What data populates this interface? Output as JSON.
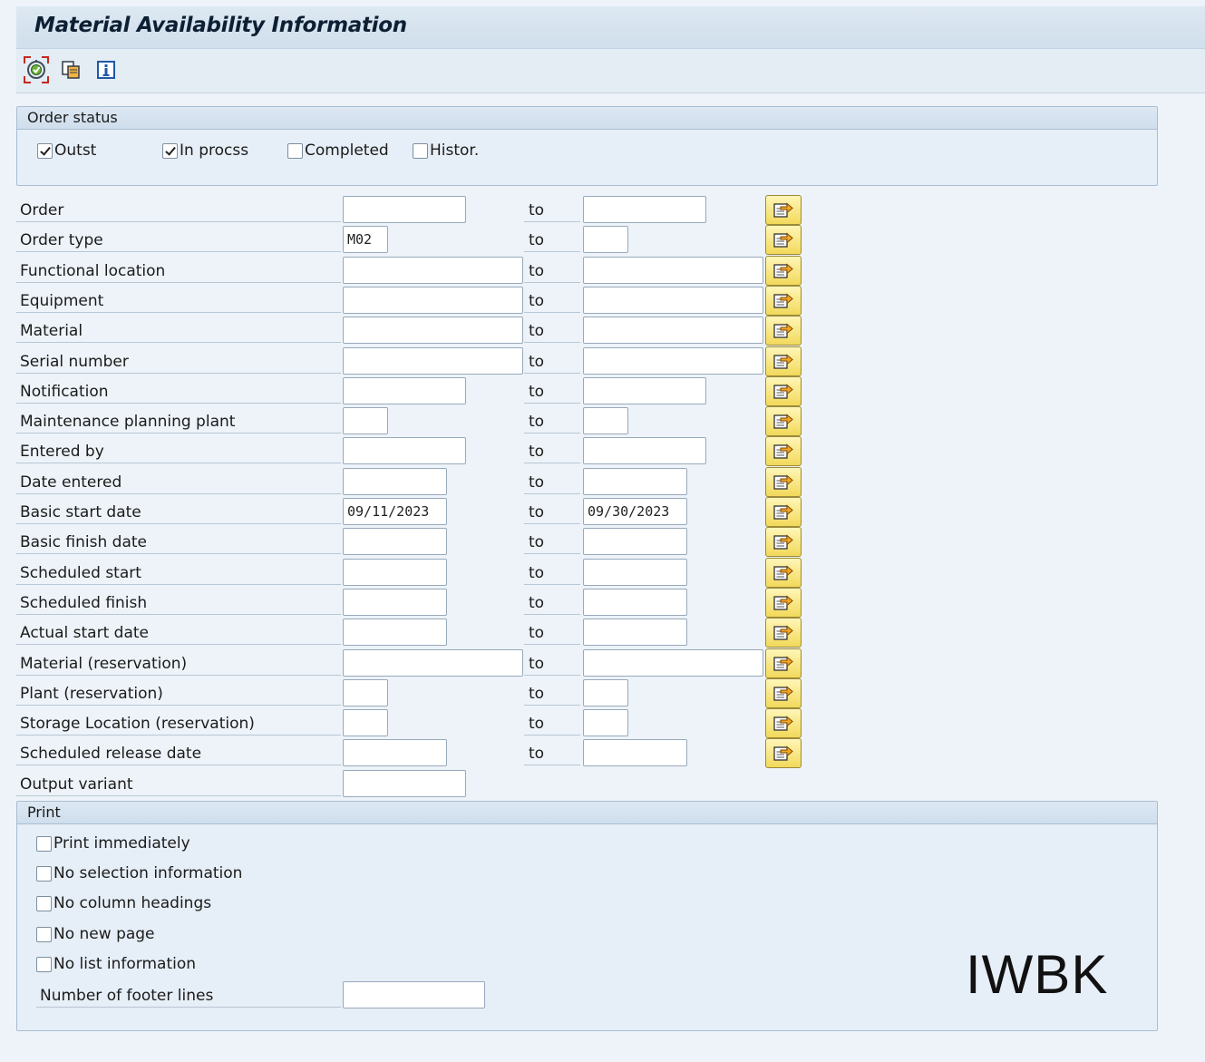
{
  "window": {
    "title": "Material Availability Information"
  },
  "toolbar": {
    "execute_icon": "execute-icon",
    "copy_icon": "copy-icon",
    "info_icon": "info-icon"
  },
  "order_status": {
    "header": "Order status",
    "options": [
      {
        "label": "Outst",
        "checked": true
      },
      {
        "label": "In procss",
        "checked": true
      },
      {
        "label": "Completed",
        "checked": false
      },
      {
        "label": "Histor.",
        "checked": false
      }
    ]
  },
  "range_to_label": "to",
  "selection_fields": [
    {
      "label": "Order",
      "from": "",
      "to": ""
    },
    {
      "label": "Order type",
      "from": "M02",
      "to": ""
    },
    {
      "label": "Functional location",
      "from": "",
      "to": ""
    },
    {
      "label": "Equipment",
      "from": "",
      "to": ""
    },
    {
      "label": "Material",
      "from": "",
      "to": ""
    },
    {
      "label": "Serial number",
      "from": "",
      "to": ""
    },
    {
      "label": "Notification",
      "from": "",
      "to": ""
    },
    {
      "label": "Maintenance planning plant",
      "from": "",
      "to": ""
    },
    {
      "label": "Entered by",
      "from": "",
      "to": ""
    },
    {
      "label": "Date entered",
      "from": "",
      "to": ""
    },
    {
      "label": "Basic start date",
      "from": "09/11/2023",
      "to": "09/30/2023"
    },
    {
      "label": "Basic finish date",
      "from": "",
      "to": ""
    },
    {
      "label": "Scheduled start",
      "from": "",
      "to": ""
    },
    {
      "label": "Scheduled finish",
      "from": "",
      "to": ""
    },
    {
      "label": "Actual start date",
      "from": "",
      "to": ""
    },
    {
      "label": "Material (reservation)",
      "from": "",
      "to": ""
    },
    {
      "label": "Plant (reservation)",
      "from": "",
      "to": ""
    },
    {
      "label": "Storage Location (reservation)",
      "from": "",
      "to": ""
    },
    {
      "label": "Scheduled release date",
      "from": "",
      "to": ""
    }
  ],
  "output_variant": {
    "label": "Output variant",
    "value": ""
  },
  "print": {
    "header": "Print",
    "options": [
      {
        "label": "Print immediately",
        "checked": false
      },
      {
        "label": "No selection information",
        "checked": false
      },
      {
        "label": "No column headings",
        "checked": false
      },
      {
        "label": "No new page",
        "checked": false
      },
      {
        "label": "No list information",
        "checked": false
      }
    ],
    "footer_lines": {
      "label": "Number of footer lines",
      "value": ""
    }
  },
  "overlay_text": "IWBK",
  "colors": {
    "accent_button": "#f2d95a",
    "background": "#edf3f9",
    "group_border": "#a8bdd2"
  }
}
